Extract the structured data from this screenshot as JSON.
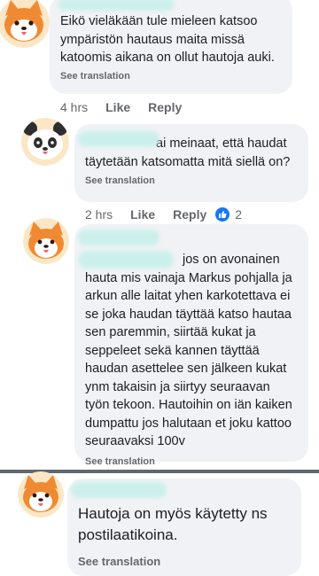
{
  "comments": [
    {
      "avatar": "shiba-avatar",
      "text": "Eikö vieläkään tule mieleen katsoo ympäristön hautaus maita missä katoomis aikana on ollut hautoja auki.",
      "see_translation": "See translation",
      "time": "4 hrs",
      "like": "Like",
      "reply": "Reply"
    },
    {
      "avatar": "panda-avatar",
      "text": "ai meinaat, että haudat täytetään katsomatta mitä siellä on?",
      "see_translation": "See translation",
      "time": "2 hrs",
      "like": "Like",
      "reply": "Reply",
      "reaction_count": "2"
    },
    {
      "avatar": "shiba-avatar",
      "text": "jos on avonainen hauta mis vainaja Markus pohjalla ja arkun alle laitat yhen karkotettava ei se joka haudan täyttää katso hautaa sen paremmin, siirtää kukat ja seppeleet sekä kannen täyttää haudan asettelee sen jälkeen kukat ynm takaisin ja siirtyy seuraavan työn tekoon. Hautoihin on iän kaiken dumpattu jos halutaan et joku kattoo seuraavaksi 100v",
      "see_translation": "See translation"
    },
    {
      "avatar": "shiba-avatar",
      "text": "Hautoja on myös käytetty ns postilaatikoina.",
      "see_translation": "See translation"
    }
  ],
  "colors": {
    "bubble": "#f0f2f5",
    "meta": "#65676b",
    "like_blue": "#1877f2"
  }
}
